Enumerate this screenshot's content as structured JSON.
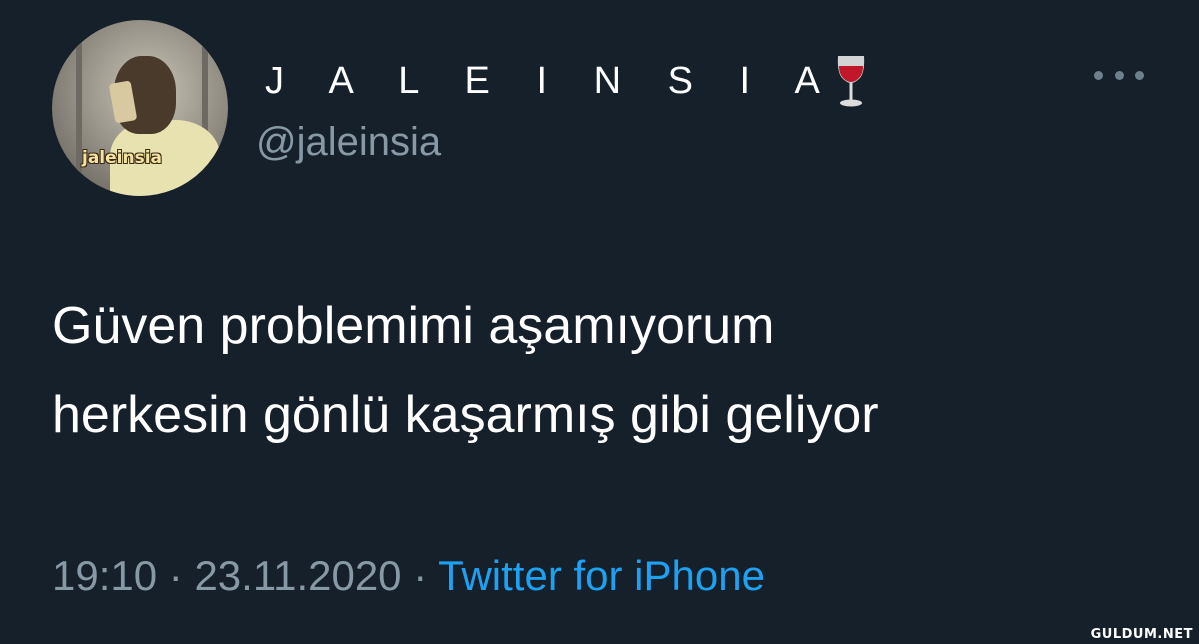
{
  "author": {
    "display_name": "J A L E I N S I A",
    "display_emoji": "wine-glass-icon",
    "handle": "@jaleinsia",
    "avatar_label": "jaleinsia"
  },
  "tweet": {
    "lines": [
      "Güven problemimi aşamıyorum",
      "herkesin gönlü kaşarmış gibi geliyor"
    ]
  },
  "meta": {
    "time": "19:10",
    "separator": "·",
    "date": "23.11.2020",
    "source": "Twitter for iPhone"
  },
  "menu": {
    "icon": "more-options-icon"
  },
  "watermark": {
    "text": "GULDUM.NET"
  },
  "colors": {
    "background": "#15202b",
    "text": "#ffffff",
    "secondary": "#8899a6",
    "link": "#1da1f2"
  }
}
